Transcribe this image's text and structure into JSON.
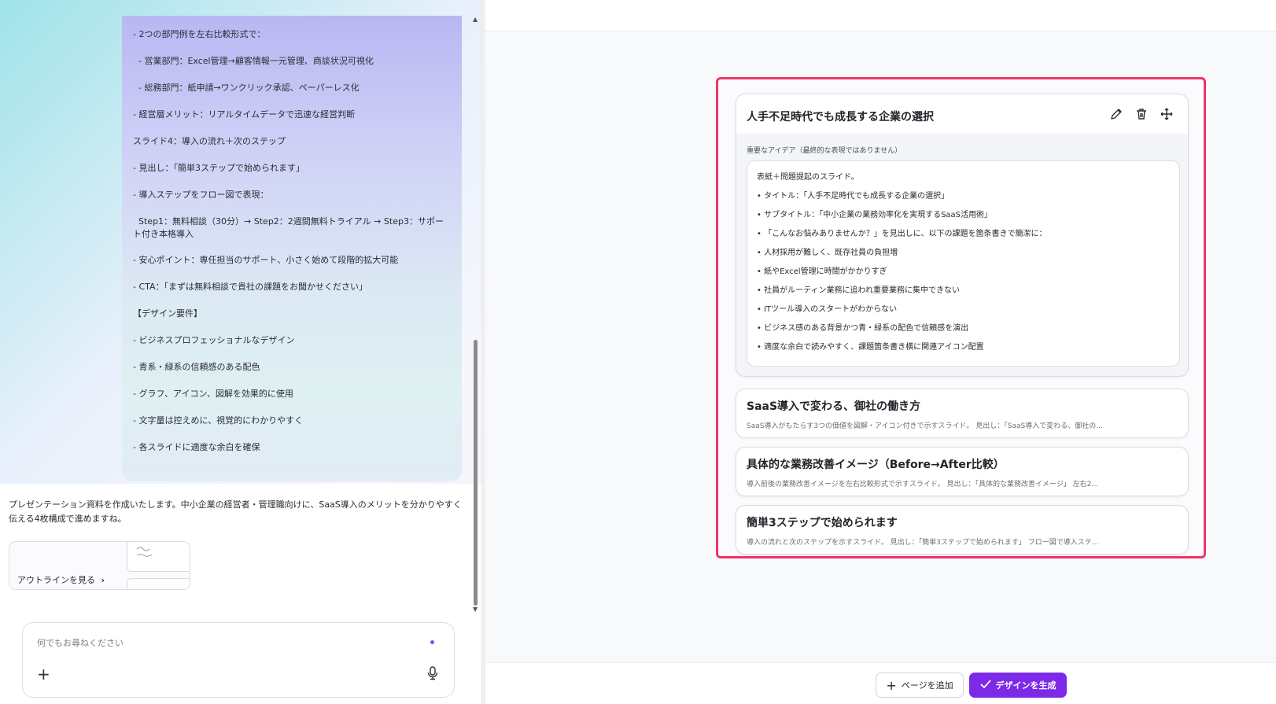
{
  "chat": {
    "user_message_lines": [
      "- 2つの部門例を左右比較形式で：",
      "  - 営業部門：Excel管理→顧客情報一元管理、商談状況可視化",
      "  - 総務部門：紙申請→ワンクリック承認、ペーパーレス化",
      "- 経営層メリット：リアルタイムデータで迅速な経営判断",
      "スライド4：導入の流れ＋次のステップ",
      "- 見出し：「簡単3ステップで始められます」",
      "- 導入ステップをフロー図で表現：",
      "  Step1：無料相談（30分）→ Step2：2週間無料トライアル → Step3：サポート付き本格導入",
      "- 安心ポイント：専任担当のサポート、小さく始めて段階的拡大可能",
      "- CTA：「まずは無料相談で貴社の課題をお聞かせください」",
      "【デザイン要件】",
      "- ビジネスプロフェッショナルなデザイン",
      "- 青系・緑系の信頼感のある配色",
      "- グラフ、アイコン、図解を効果的に使用",
      "- 文字量は控えめに、視覚的にわかりやすく",
      "- 各スライドに適度な余白を確保"
    ],
    "assistant_message": "プレゼンテーション資料を作成いたします。中小企業の経営者・管理職向けに、SaaS導入のメリットを分かりやすく伝える4枚構成で進めますね。",
    "outline_button_label": "アウトラインを見る",
    "input_placeholder": "何でもお尋ねください"
  },
  "editor": {
    "slides": [
      {
        "title": "人手不足時代でも成長する企業の選択",
        "key_idea_label": "重要なアイデア（最終的な表現ではありません）",
        "idea_lines": [
          "表紙＋問題提起のスライド。",
          "• タイトル：「人手不足時代でも成長する企業の選択」",
          "• サブタイトル：「中小企業の業務効率化を実現するSaaS活用術」",
          "• 「こんなお悩みありませんか？」を見出しに、以下の課題を箇条書きで簡潔に：",
          "• 人材採用が難しく、既存社員の負担増",
          "• 紙やExcel管理に時間がかかりすぎ",
          "• 社員がルーティン業務に追われ重要業務に集中できない",
          "• ITツール導入のスタートがわからない",
          "• ビジネス感のある背景かつ青・緑系の配色で信頼感を演出",
          "• 適度な余白で読みやすく、課題箇条書き横に関連アイコン配置"
        ]
      },
      {
        "title": "SaaS導入で変わる、御社の働き方",
        "summary": "SaaS導入がもたらす3つの価値を図解・アイコン付きで示すスライド。 見出し：「SaaS導入で変わる、御社の..."
      },
      {
        "title": "具体的な業務改善イメージ（Before→After比較）",
        "summary": "導入前後の業務改善イメージを左右比較形式で示すスライド。 見出し：「具体的な業務改善イメージ」 左右2..."
      },
      {
        "title": "簡単3ステップで始められます",
        "summary": "導入の流れと次のステップを示すスライド。 見出し：「簡単3ステップで始められます」 フロー図で導入ステ..."
      }
    ],
    "add_page_label": "ページを追加",
    "generate_label": "デザインを生成"
  },
  "icons": {
    "edit": "pencil-icon",
    "delete": "trash-icon",
    "move": "move-icon",
    "mic": "mic-icon",
    "plus": "plus-icon",
    "check": "check-icon"
  },
  "colors": {
    "highlight": "#ee3468",
    "primary": "#7d2ae8"
  }
}
